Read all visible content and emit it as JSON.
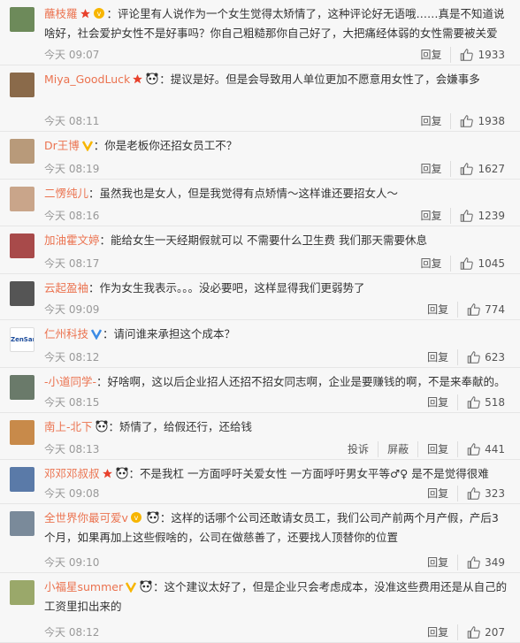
{
  "comments": [
    {
      "user": "蘸枝羅",
      "badges": [
        "star",
        "vip-icon"
      ],
      "text": "：评论里有人说作为一个女生觉得太矫情了，这种评论好无语哦……真是不知道说啥好，社会爱护女性不是好事吗？你自己粗糙那你自己好了，大把痛经体弱的女性需要被关爱",
      "time": "今天 09:07",
      "actions": [
        "回复"
      ],
      "likes": "1933",
      "avatar_color": "#6d8a5a"
    },
    {
      "user": "Miya_GoodLuck",
      "badges": [
        "star",
        "panda-icon"
      ],
      "text": "：提议是好。但是会导致用人单位更加不愿意用女性了，会嫌事多",
      "time": "今天 08:11",
      "actions": [
        "回复"
      ],
      "likes": "1938",
      "avatar_color": "#8a6a4a"
    },
    {
      "user": "Dr王博",
      "badges": [
        "v-yellow"
      ],
      "text": "：你是老板你还招女员工不？",
      "time": "今天 08:19",
      "actions": [
        "回复"
      ],
      "likes": "1627",
      "avatar_color": "#b89a7a"
    },
    {
      "user": "二愣纯儿",
      "badges": [],
      "text": "：虽然我也是女人，但是我觉得有点矫情～这样谁还要招女人～",
      "time": "今天 08:16",
      "actions": [
        "回复"
      ],
      "likes": "1239",
      "avatar_color": "#c9a58a"
    },
    {
      "user": "加油霍文婷",
      "badges": [],
      "text": "：能给女生一天经期假就可以 不需要什么卫生费 我们那天需要休息",
      "time": "今天 08:17",
      "actions": [
        "回复"
      ],
      "likes": "1045",
      "avatar_color": "#a84a4a"
    },
    {
      "user": "云起盈袖",
      "badges": [],
      "text": "：作为女生我表示。。。没必要吧，这样显得我们更弱势了",
      "time": "今天 09:09",
      "actions": [
        "回复"
      ],
      "likes": "774",
      "avatar_color": "#555555"
    },
    {
      "user": "仁州科技",
      "badges": [
        "v-blue"
      ],
      "text": "：请问谁来承担这个成本？",
      "time": "今天 08:12",
      "actions": [
        "回复"
      ],
      "likes": "623",
      "avatar_color": "#ffffff",
      "avatar_text": "ZenSar"
    },
    {
      "user": "-小道同学-",
      "badges": [],
      "text": "：好啥啊，这以后企业招人还招不招女同志啊，企业是要赚钱的啊，不是来奉献的。",
      "time": "今天 08:15",
      "actions": [
        "回复"
      ],
      "likes": "518",
      "avatar_color": "#6a7a6a"
    },
    {
      "user": "南上-北下",
      "badges": [
        "panda-icon"
      ],
      "text": "：矫情了，给假还行，还给钱",
      "time": "今天 08:13",
      "actions": [
        "投诉",
        "屏蔽",
        "回复"
      ],
      "likes": "441",
      "avatar_color": "#c88a4a"
    },
    {
      "user": "邓邓邓叔叔",
      "badges": [
        "star",
        "panda-icon"
      ],
      "text": "：不是我杠 一方面呼吁关爱女性 一方面呼吁男女平等♂♀ 是不是觉得很难",
      "time": "今天 09:08",
      "actions": [
        "回复"
      ],
      "likes": "323",
      "avatar_color": "#5a7aa8"
    },
    {
      "user": "全世界你最可爱v",
      "badges": [
        "vip-icon",
        "panda-icon"
      ],
      "text": "：这样的话哪个公司还敢请女员工，我们公司产前两个月产假，产后3个月，如果再加上这些假啥的，公司在做慈善了，还要找人顶替你的位置",
      "time": "今天 09:10",
      "actions": [
        "回复"
      ],
      "likes": "349",
      "avatar_color": "#7a8a9a"
    },
    {
      "user": "小福星summer",
      "badges": [
        "v-yellow",
        "panda-icon"
      ],
      "text": "：这个建议太好了，但是企业只会考虑成本，没准这些费用还是从自己的工资里扣出来的",
      "time": "今天 08:12",
      "actions": [
        "回复"
      ],
      "likes": "207",
      "avatar_color": "#9aa86a"
    }
  ]
}
